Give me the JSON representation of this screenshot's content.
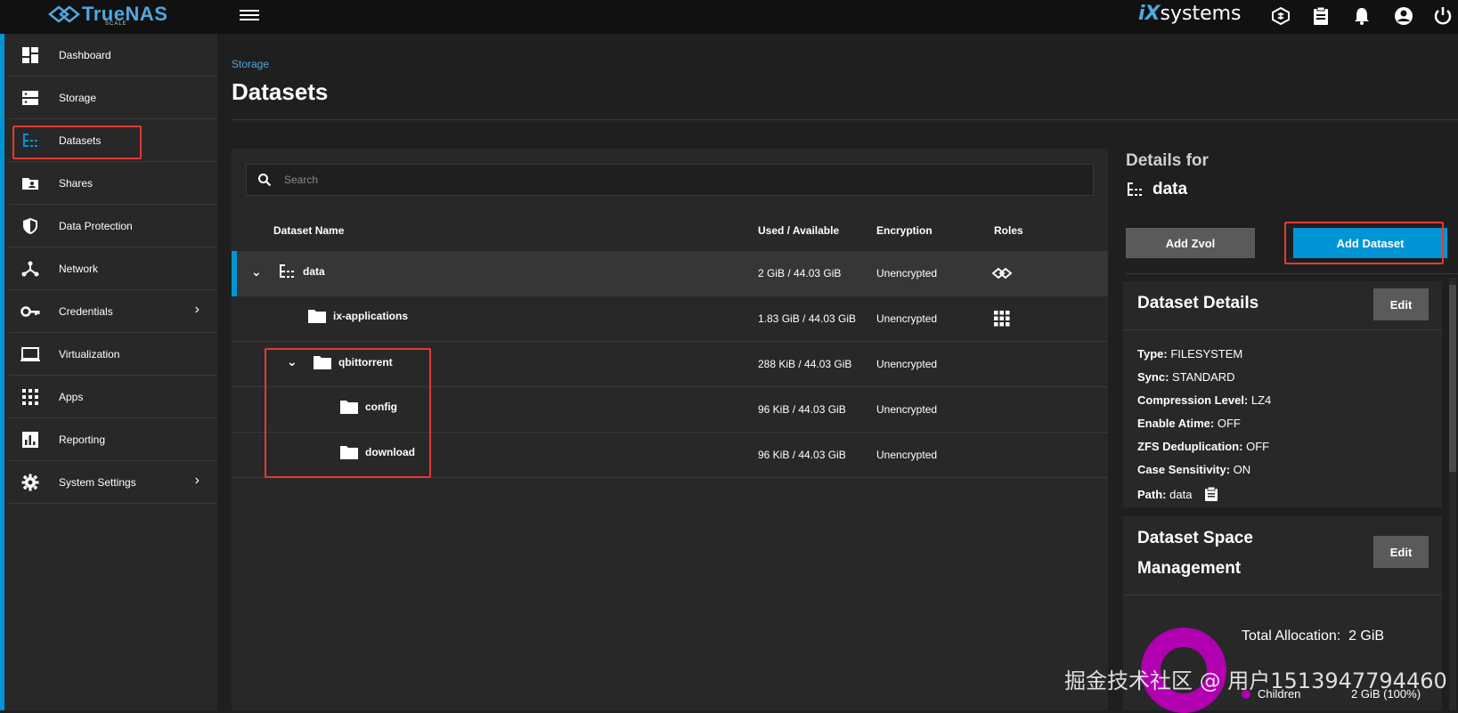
{
  "topbar": {
    "logo_text": "TrueNAS",
    "logo_sub": "SCALE",
    "vendor_logo_prefix": "iX",
    "vendor_logo_suffix": "systems",
    "icons": [
      "truecommand-icon",
      "clipboard-icon",
      "bell-icon",
      "account-icon",
      "power-icon"
    ]
  },
  "sidebar": {
    "items": [
      {
        "label": "Dashboard",
        "icon": "dashboard-icon"
      },
      {
        "label": "Storage",
        "icon": "storage-icon"
      },
      {
        "label": "Datasets",
        "icon": "datasets-icon",
        "active": true
      },
      {
        "label": "Shares",
        "icon": "shares-icon"
      },
      {
        "label": "Data Protection",
        "icon": "shield-icon"
      },
      {
        "label": "Network",
        "icon": "network-icon"
      },
      {
        "label": "Credentials",
        "icon": "key-icon",
        "chevron": true
      },
      {
        "label": "Virtualization",
        "icon": "monitor-icon"
      },
      {
        "label": "Apps",
        "icon": "apps-icon"
      },
      {
        "label": "Reporting",
        "icon": "chart-icon"
      },
      {
        "label": "System Settings",
        "icon": "gear-icon",
        "chevron": true
      }
    ]
  },
  "header": {
    "breadcrumb": "Storage",
    "title": "Datasets"
  },
  "search": {
    "placeholder": "Search",
    "value": ""
  },
  "table": {
    "columns": [
      "Dataset Name",
      "Used / Available",
      "Encryption",
      "Roles"
    ],
    "rows": [
      {
        "name": "data",
        "used": "2 GiB / 44.03 GiB",
        "encryption": "Unencrypted",
        "expanded": true,
        "selected": true,
        "icon": "dataset-tree-icon",
        "role_icon": "truenas-role-icon"
      },
      {
        "name": "ix-applications",
        "used": "1.83 GiB / 44.03 GiB",
        "encryption": "Unencrypted",
        "icon": "folder-icon",
        "role_icon": "apps-role-icon"
      },
      {
        "name": "qbittorrent",
        "used": "288 KiB / 44.03 GiB",
        "encryption": "Unencrypted",
        "expanded": true,
        "icon": "folder-icon"
      },
      {
        "name": "config",
        "used": "96 KiB / 44.03 GiB",
        "encryption": "Unencrypted",
        "icon": "folder-icon"
      },
      {
        "name": "download",
        "used": "96 KiB / 44.03 GiB",
        "encryption": "Unencrypted",
        "icon": "folder-icon"
      }
    ]
  },
  "details": {
    "heading": "Details for",
    "dataset_name": "data",
    "add_zvol_label": "Add Zvol",
    "add_dataset_label": "Add Dataset",
    "dataset_details": {
      "title": "Dataset Details",
      "edit_label": "Edit",
      "fields": [
        {
          "key": "Type:",
          "value": "FILESYSTEM"
        },
        {
          "key": "Sync:",
          "value": "STANDARD"
        },
        {
          "key": "Compression Level:",
          "value": "LZ4"
        },
        {
          "key": "Enable Atime:",
          "value": "OFF"
        },
        {
          "key": "ZFS Deduplication:",
          "value": "OFF"
        },
        {
          "key": "Case Sensitivity:",
          "value": "ON"
        },
        {
          "key": "Path:",
          "value": "data"
        }
      ]
    },
    "space_management": {
      "title_line1": "Dataset Space",
      "title_line2": "Management",
      "edit_label": "Edit",
      "total_allocation_label": "Total Allocation:",
      "total_allocation_value": "2 GiB",
      "legend": [
        {
          "label": "Children",
          "value": "2 GiB (100%)",
          "color": "#b000b0"
        }
      ]
    }
  },
  "colors": {
    "accent": "#0095d5",
    "highlight_box": "#e53935",
    "donut": "#b000b0"
  },
  "watermark": "掘金技术社区 @ 用户1513947794460"
}
